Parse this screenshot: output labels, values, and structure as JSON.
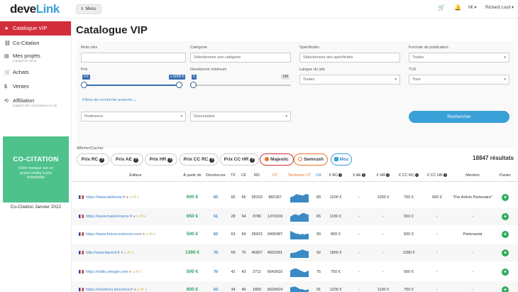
{
  "topbar": {
    "logo_prefix": "deve",
    "logo_suffix": "Link",
    "menu_label": "Menu",
    "cart_icon": "cart-icon",
    "bell_icon": "bell-icon",
    "balance": "0€ ▾",
    "user_name": "Richard Louit ▾"
  },
  "sidebar": {
    "items": [
      {
        "label": "Catalogue VIP",
        "icon": "star-icon",
        "sub": ""
      },
      {
        "label": "Co-Citation",
        "icon": "link-icon",
        "sub": ""
      },
      {
        "label": "Mes projets",
        "icon": "folder-icon",
        "sub": "0 projet en cours"
      },
      {
        "label": "Achats",
        "icon": "cart-icon",
        "sub": ""
      },
      {
        "label": "Ventes",
        "icon": "dollar-icon",
        "sub": ""
      },
      {
        "label": "Affiliation",
        "icon": "share-icon",
        "sub": "Gagnez des commissions à vie"
      }
    ],
    "promo_title": "CO-CITATION",
    "promo_desc": "Votre marque sur un grand média à prix imbattable",
    "promo_caption": "Co-Citation Janvier 2022"
  },
  "page": {
    "title": "Catalogue VIP"
  },
  "filters": {
    "keywords_label": "Mots clés",
    "keywords_value": "",
    "category_label": "Catégorie",
    "category_placeholder": "Sélectionnez une catégorie",
    "specifics_label": "Spécificités",
    "specifics_placeholder": "Sélectionnez des spécificités",
    "formula_label": "Formule de publication",
    "formula_value": "Toutes",
    "price_label": "Prix",
    "price_min": "0 €",
    "price_max": "≥ 5000 €",
    "price_fraction_min": 0,
    "price_fraction_max": 1,
    "develscore_label": "Develscore minimum",
    "develscore_min": "0",
    "develscore_max": "100",
    "language_label": "Langue du site",
    "language_value": "Toutes",
    "tld_label": "TLD",
    "tld_value": "Tous",
    "advanced_label": "Filtres de recherche avancés",
    "sort_value": "Pertinence",
    "order_value": "Descendant",
    "search_label": "Rechercher"
  },
  "results_count": "18847 résultats",
  "toggles": {
    "label": "Afficher/Cacher",
    "buttons": [
      "Prix RC",
      "Prix AE",
      "Prix HR",
      "Prix CC RC",
      "Prix CC HR",
      "Majestic",
      "Semrush",
      "Moz"
    ]
  },
  "table": {
    "headers": [
      "Éditeur",
      "À partir de",
      "Develscore",
      "TF",
      "CF",
      "RD",
      "OT",
      "Tendance OT",
      "OA",
      "€ RC",
      "€ AE",
      "€ HR",
      "€ CC RC",
      "€ CC HR",
      "Mention",
      "Panier"
    ],
    "rows": [
      {
        "site": "https://www.latribune.fr",
        "price": "600 €",
        "ds": "60",
        "tf": "65",
        "cf": "65",
        "rd": "28103",
        "ot": "883187",
        "oa": "89",
        "rc": "1200 €",
        "ae": "-",
        "hr": "1050 €",
        "ccrc": "750 €",
        "cchr": "600 €",
        "mention": "\"Par Article Partenaire\"",
        "trend": [
          6,
          7,
          8,
          10,
          9,
          9,
          8,
          9,
          10,
          9
        ]
      },
      {
        "site": "https://www.marieFrance.fr",
        "price": "650 €",
        "ds": "51",
        "tf": "28",
        "cf": "54",
        "rd": "3786",
        "ot": "1370159",
        "oa": "65",
        "rc": "1150 €",
        "ae": "-",
        "hr": "-",
        "ccrc": "650 €",
        "cchr": "-",
        "mention": "-",
        "trend": [
          4,
          5,
          6,
          6,
          5,
          6,
          7,
          7,
          6,
          6
        ]
      },
      {
        "site": "https://www.futura-sciences.com",
        "price": "500 €",
        "ds": "62",
        "tf": "63",
        "cf": "69",
        "rd": "28423",
        "ot": "9406487",
        "oa": "90",
        "rc": "800 €",
        "ae": "-",
        "hr": "-",
        "ccrc": "500 €",
        "cchr": "-",
        "mention": "Partenariat",
        "trend": [
          9,
          8,
          7,
          6,
          6,
          5,
          6,
          5,
          6,
          6
        ]
      },
      {
        "site": "http://www.lepoint.fr",
        "price": "1390 €",
        "ds": "70",
        "tf": "69",
        "cf": "75",
        "rd": "46907",
        "ot": "4831561",
        "oa": "92",
        "rc": "1850 €",
        "ae": "-",
        "hr": "-",
        "ccrc": "1390 €",
        "cchr": "-",
        "mention": "-",
        "trend": [
          5,
          6,
          6,
          7,
          8,
          9,
          10,
          9,
          8,
          8
        ]
      },
      {
        "site": "https://edito.seloger.com",
        "price": "500 €",
        "ds": "70",
        "tf": "42",
        "cf": "43",
        "rd": "2711",
        "ot": "6643916",
        "oa": "75",
        "rc": "750 €",
        "ae": "-",
        "hr": "-",
        "ccrc": "500 €",
        "cchr": "-",
        "mention": "-",
        "trend": [
          7,
          8,
          9,
          9,
          8,
          7,
          6,
          5,
          6,
          7
        ]
      },
      {
        "site": "https://solutions.lesechos.fr",
        "price": "600 €",
        "ds": "63",
        "tf": "34",
        "cf": "46",
        "rd": "1850",
        "ot": "6629424",
        "oa": "91",
        "rc": "1200 €",
        "ae": "-",
        "hr": "1100 €",
        "ccrc": "750 €",
        "cchr": "-",
        "mention": "-",
        "trend": [
          8,
          8,
          9,
          8,
          7,
          6,
          6,
          5,
          5,
          6
        ]
      }
    ]
  },
  "colors": {
    "accent": "#d22d3b",
    "link": "#3a7cc8",
    "price": "#2a9d5a",
    "trend": "#3a8ac6",
    "promo": "#4fc28c",
    "button": "#3aa0d8"
  }
}
